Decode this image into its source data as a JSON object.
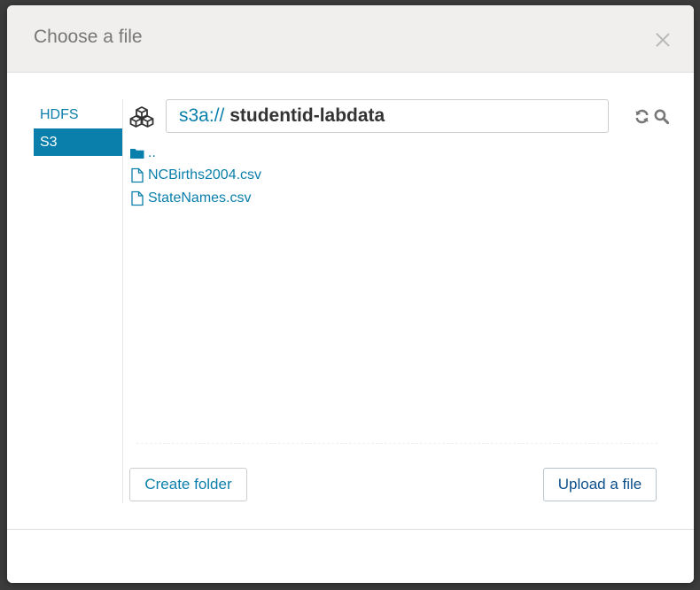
{
  "dialog": {
    "title": "Choose a file"
  },
  "sidebar": {
    "items": [
      {
        "label": "HDFS",
        "active": false
      },
      {
        "label": "S3",
        "active": true
      }
    ]
  },
  "path": {
    "scheme": "s3a://",
    "bucket": "studentid-labdata"
  },
  "files": [
    {
      "name": "..",
      "type": "folder"
    },
    {
      "name": "NCBirths2004.csv",
      "type": "file"
    },
    {
      "name": "StateNames.csv",
      "type": "file"
    }
  ],
  "actions": {
    "create_folder": "Create folder",
    "upload_file": "Upload a file"
  },
  "colors": {
    "accent": "#0b7fab",
    "header_bg": "#f0efee",
    "backdrop": "#3c3c3c"
  },
  "icons": {
    "connector": "cubes-icon",
    "refresh": "refresh-icon",
    "search": "search-icon",
    "folder": "folder-icon",
    "file": "file-icon",
    "close": "close-icon"
  }
}
